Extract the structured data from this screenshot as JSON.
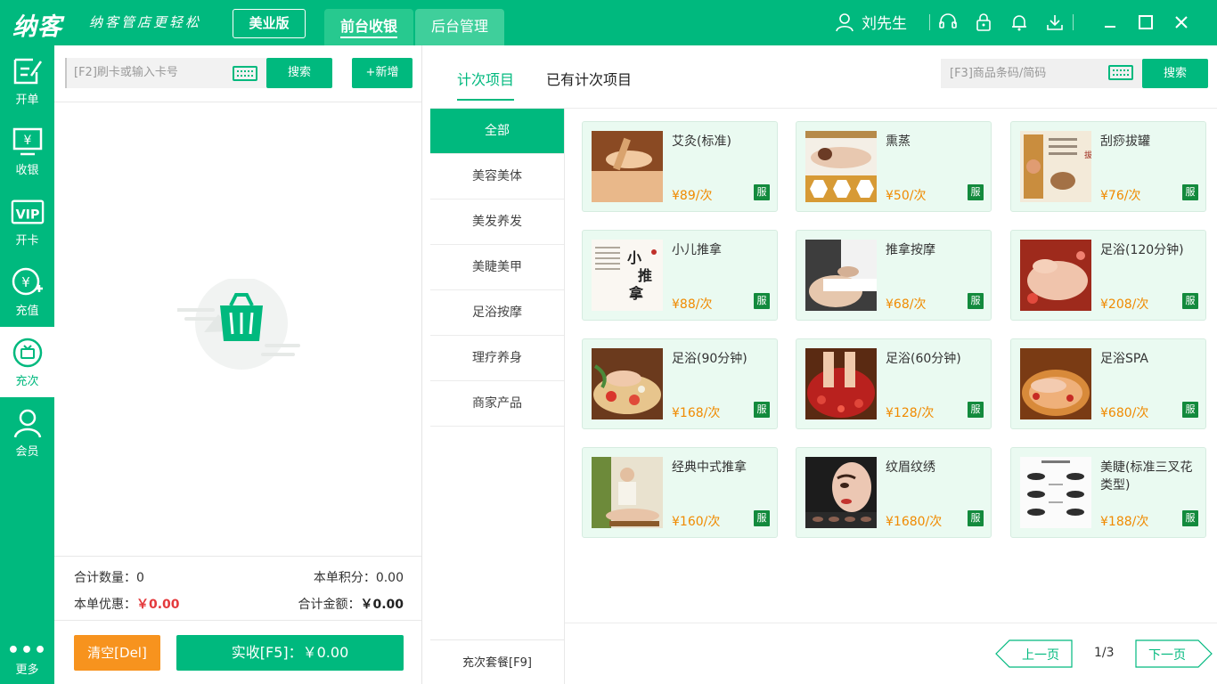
{
  "topbar": {
    "logo": "纳客",
    "slogan": "纳客管店更轻松",
    "edition": "美业版",
    "tabs": [
      {
        "label": "前台收银"
      },
      {
        "label": "后台管理"
      }
    ],
    "user_name": "刘先生",
    "icons": [
      "headset-icon",
      "lock-icon",
      "bell-icon",
      "download-icon"
    ],
    "colors": {
      "brand": "#00b97e",
      "price": "#f08a00",
      "discount": "#e4393c",
      "clear_button": "#f7931e"
    }
  },
  "sidebar": {
    "items": [
      {
        "label": "开单",
        "icon": "edit-order-icon"
      },
      {
        "label": "收银",
        "icon": "cashier-icon"
      },
      {
        "label": "开卡",
        "icon": "vip-card-icon"
      },
      {
        "label": "充值",
        "icon": "recharge-icon"
      },
      {
        "label": "充次",
        "icon": "count-card-icon"
      },
      {
        "label": "会员",
        "icon": "member-icon"
      }
    ],
    "more": "更多",
    "active_index": 4
  },
  "left": {
    "card_placeholder": "[F2]刷卡或输入卡号",
    "search_label": "搜索",
    "add_label": "+新增",
    "total_qty_label": "合计数量：",
    "total_qty": "0",
    "points_label": "本单积分：",
    "points": "0.00",
    "discount_label": "本单优惠：",
    "discount": "￥0.00",
    "amount_label": "合计金额：",
    "amount": "￥0.00",
    "clear_label": "清空[Del]",
    "pay_label": "实收[F5]：￥0.00"
  },
  "right": {
    "tabs": [
      {
        "label": "计次项目"
      },
      {
        "label": "已有计次项目"
      }
    ],
    "product_placeholder": "[F3]商品条码/简码",
    "search_label": "搜索",
    "categories": [
      "全部",
      "美容美体",
      "美发养发",
      "美睫美甲",
      "足浴按摩",
      "理疗养身",
      "商家产品"
    ],
    "category_footer": "充次套餐[F9]",
    "badge": "服",
    "products": [
      {
        "name": "艾灸(标准)",
        "price": "¥89/次"
      },
      {
        "name": "熏蒸",
        "price": "¥50/次"
      },
      {
        "name": "刮痧拔罐",
        "price": "¥76/次"
      },
      {
        "name": "小儿推拿",
        "price": "¥88/次"
      },
      {
        "name": "推拿按摩",
        "price": "¥68/次"
      },
      {
        "name": "足浴(120分钟)",
        "price": "¥208/次"
      },
      {
        "name": "足浴(90分钟)",
        "price": "¥168/次"
      },
      {
        "name": "足浴(60分钟)",
        "price": "¥128/次"
      },
      {
        "name": "足浴SPA",
        "price": "¥680/次"
      },
      {
        "name": "经典中式推拿",
        "price": "¥160/次"
      },
      {
        "name": "纹眉纹绣",
        "price": "¥1680/次"
      },
      {
        "name": "美睫(标准三叉花类型)",
        "price": "¥188/次"
      }
    ],
    "prev_label": "上一页",
    "page_indicator": "1/3",
    "next_label": "下一页"
  }
}
